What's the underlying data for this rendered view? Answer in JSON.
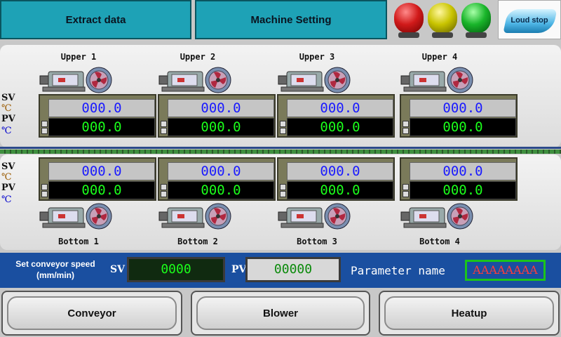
{
  "top": {
    "extract_label": "Extract data",
    "machine_label": "Machine Setting",
    "loud_stop_label": "Loud stop",
    "lamps": [
      {
        "name": "red",
        "color": "#d11a1a"
      },
      {
        "name": "yellow",
        "color": "#c9c400"
      },
      {
        "name": "green",
        "color": "#19b52a"
      }
    ]
  },
  "units": {
    "sv": "SV",
    "pv": "PV",
    "celsius": "℃"
  },
  "upper": {
    "zones": [
      {
        "label": "Upper 1",
        "sv": "000.0",
        "pv": "000.0"
      },
      {
        "label": "Upper 2",
        "sv": "000.0",
        "pv": "000.0"
      },
      {
        "label": "Upper 3",
        "sv": "000.0",
        "pv": "000.0"
      },
      {
        "label": "Upper 4",
        "sv": "000.0",
        "pv": "000.0"
      }
    ]
  },
  "bottom": {
    "zones": [
      {
        "label": "Bottom 1",
        "sv": "000.0",
        "pv": "000.0"
      },
      {
        "label": "Bottom 2",
        "sv": "000.0",
        "pv": "000.0"
      },
      {
        "label": "Bottom 3",
        "sv": "000.0",
        "pv": "000.0"
      },
      {
        "label": "Bottom 4",
        "sv": "000.0",
        "pv": "000.0"
      }
    ]
  },
  "conveyor": {
    "label": "Set conveyor speed (mm/min)",
    "sv_label": "SV",
    "sv_value": "0000",
    "pv_label": "PV",
    "pv_value": "00000",
    "param_label": "Parameter name",
    "param_value": "AAAAAAAA"
  },
  "buttons": {
    "conveyor": "Conveyor",
    "blower": "Blower",
    "heatup": "Heatup"
  },
  "colors": {
    "accent": "#1ea2b6",
    "bar": "#1a4fa0",
    "sv_text": "#1a1aff",
    "pv_text": "#1bff1b"
  }
}
